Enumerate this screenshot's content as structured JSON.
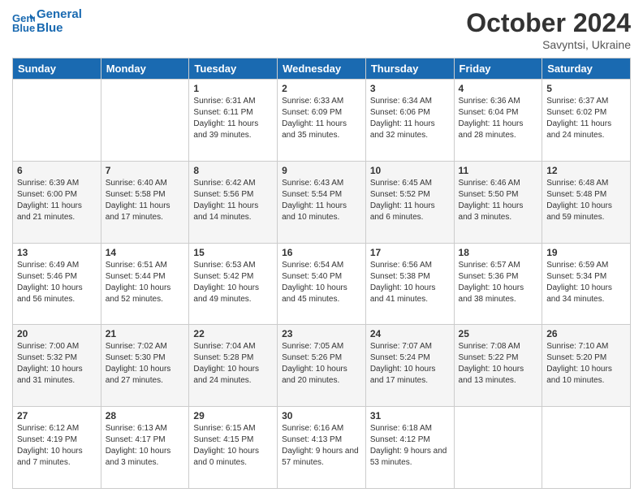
{
  "header": {
    "logo_line1": "General",
    "logo_line2": "Blue",
    "month": "October 2024",
    "location": "Savyntsi, Ukraine"
  },
  "days_of_week": [
    "Sunday",
    "Monday",
    "Tuesday",
    "Wednesday",
    "Thursday",
    "Friday",
    "Saturday"
  ],
  "weeks": [
    [
      {
        "day": "",
        "info": ""
      },
      {
        "day": "",
        "info": ""
      },
      {
        "day": "1",
        "info": "Sunrise: 6:31 AM\nSunset: 6:11 PM\nDaylight: 11 hours and 39 minutes."
      },
      {
        "day": "2",
        "info": "Sunrise: 6:33 AM\nSunset: 6:09 PM\nDaylight: 11 hours and 35 minutes."
      },
      {
        "day": "3",
        "info": "Sunrise: 6:34 AM\nSunset: 6:06 PM\nDaylight: 11 hours and 32 minutes."
      },
      {
        "day": "4",
        "info": "Sunrise: 6:36 AM\nSunset: 6:04 PM\nDaylight: 11 hours and 28 minutes."
      },
      {
        "day": "5",
        "info": "Sunrise: 6:37 AM\nSunset: 6:02 PM\nDaylight: 11 hours and 24 minutes."
      }
    ],
    [
      {
        "day": "6",
        "info": "Sunrise: 6:39 AM\nSunset: 6:00 PM\nDaylight: 11 hours and 21 minutes."
      },
      {
        "day": "7",
        "info": "Sunrise: 6:40 AM\nSunset: 5:58 PM\nDaylight: 11 hours and 17 minutes."
      },
      {
        "day": "8",
        "info": "Sunrise: 6:42 AM\nSunset: 5:56 PM\nDaylight: 11 hours and 14 minutes."
      },
      {
        "day": "9",
        "info": "Sunrise: 6:43 AM\nSunset: 5:54 PM\nDaylight: 11 hours and 10 minutes."
      },
      {
        "day": "10",
        "info": "Sunrise: 6:45 AM\nSunset: 5:52 PM\nDaylight: 11 hours and 6 minutes."
      },
      {
        "day": "11",
        "info": "Sunrise: 6:46 AM\nSunset: 5:50 PM\nDaylight: 11 hours and 3 minutes."
      },
      {
        "day": "12",
        "info": "Sunrise: 6:48 AM\nSunset: 5:48 PM\nDaylight: 10 hours and 59 minutes."
      }
    ],
    [
      {
        "day": "13",
        "info": "Sunrise: 6:49 AM\nSunset: 5:46 PM\nDaylight: 10 hours and 56 minutes."
      },
      {
        "day": "14",
        "info": "Sunrise: 6:51 AM\nSunset: 5:44 PM\nDaylight: 10 hours and 52 minutes."
      },
      {
        "day": "15",
        "info": "Sunrise: 6:53 AM\nSunset: 5:42 PM\nDaylight: 10 hours and 49 minutes."
      },
      {
        "day": "16",
        "info": "Sunrise: 6:54 AM\nSunset: 5:40 PM\nDaylight: 10 hours and 45 minutes."
      },
      {
        "day": "17",
        "info": "Sunrise: 6:56 AM\nSunset: 5:38 PM\nDaylight: 10 hours and 41 minutes."
      },
      {
        "day": "18",
        "info": "Sunrise: 6:57 AM\nSunset: 5:36 PM\nDaylight: 10 hours and 38 minutes."
      },
      {
        "day": "19",
        "info": "Sunrise: 6:59 AM\nSunset: 5:34 PM\nDaylight: 10 hours and 34 minutes."
      }
    ],
    [
      {
        "day": "20",
        "info": "Sunrise: 7:00 AM\nSunset: 5:32 PM\nDaylight: 10 hours and 31 minutes."
      },
      {
        "day": "21",
        "info": "Sunrise: 7:02 AM\nSunset: 5:30 PM\nDaylight: 10 hours and 27 minutes."
      },
      {
        "day": "22",
        "info": "Sunrise: 7:04 AM\nSunset: 5:28 PM\nDaylight: 10 hours and 24 minutes."
      },
      {
        "day": "23",
        "info": "Sunrise: 7:05 AM\nSunset: 5:26 PM\nDaylight: 10 hours and 20 minutes."
      },
      {
        "day": "24",
        "info": "Sunrise: 7:07 AM\nSunset: 5:24 PM\nDaylight: 10 hours and 17 minutes."
      },
      {
        "day": "25",
        "info": "Sunrise: 7:08 AM\nSunset: 5:22 PM\nDaylight: 10 hours and 13 minutes."
      },
      {
        "day": "26",
        "info": "Sunrise: 7:10 AM\nSunset: 5:20 PM\nDaylight: 10 hours and 10 minutes."
      }
    ],
    [
      {
        "day": "27",
        "info": "Sunrise: 6:12 AM\nSunset: 4:19 PM\nDaylight: 10 hours and 7 minutes."
      },
      {
        "day": "28",
        "info": "Sunrise: 6:13 AM\nSunset: 4:17 PM\nDaylight: 10 hours and 3 minutes."
      },
      {
        "day": "29",
        "info": "Sunrise: 6:15 AM\nSunset: 4:15 PM\nDaylight: 10 hours and 0 minutes."
      },
      {
        "day": "30",
        "info": "Sunrise: 6:16 AM\nSunset: 4:13 PM\nDaylight: 9 hours and 57 minutes."
      },
      {
        "day": "31",
        "info": "Sunrise: 6:18 AM\nSunset: 4:12 PM\nDaylight: 9 hours and 53 minutes."
      },
      {
        "day": "",
        "info": ""
      },
      {
        "day": "",
        "info": ""
      }
    ]
  ]
}
